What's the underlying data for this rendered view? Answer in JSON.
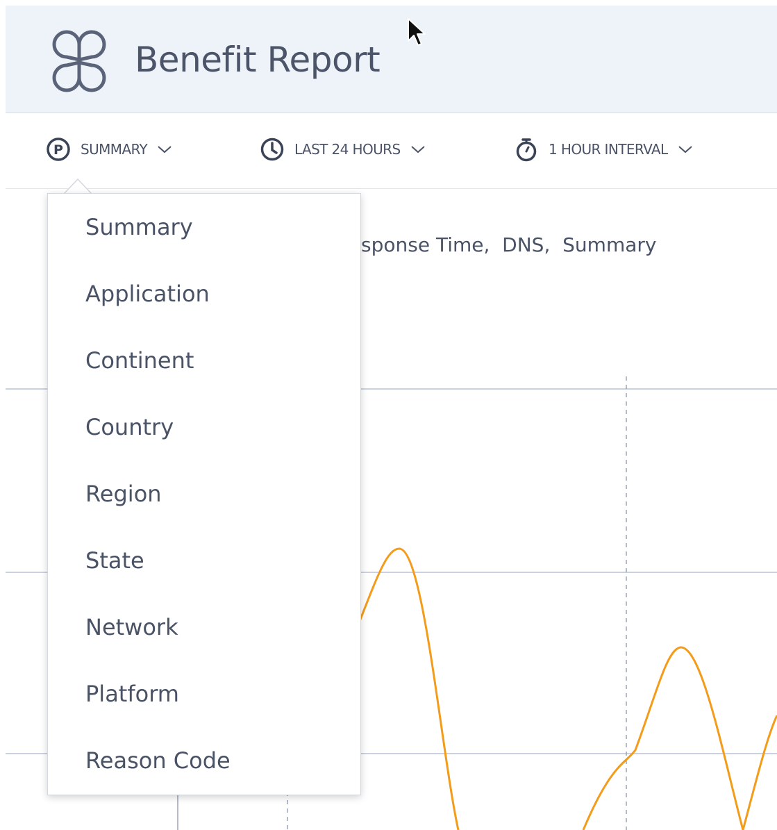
{
  "header": {
    "title": "Benefit Report",
    "logo_icon": "citrix-logo-icon"
  },
  "toolbar": {
    "items": [
      {
        "label": "SUMMARY",
        "icon": "p-circle-icon"
      },
      {
        "label": "LAST 24 HOURS",
        "icon": "clock-icon"
      },
      {
        "label": "1 HOUR INTERVAL",
        "icon": "stopwatch-icon"
      }
    ]
  },
  "chart": {
    "filter_text": "sponse Time,  DNS,  Summary",
    "line_color": "#f39c1a"
  },
  "dropdown": {
    "items": [
      "Summary",
      "Application",
      "Continent",
      "Country",
      "Region",
      "State",
      "Network",
      "Platform",
      "Reason Code"
    ]
  },
  "colors": {
    "header_bg": "#eef3f9",
    "text": "#4a5266",
    "accent_line": "#f39c1a",
    "grid": "#b9c2d6"
  }
}
